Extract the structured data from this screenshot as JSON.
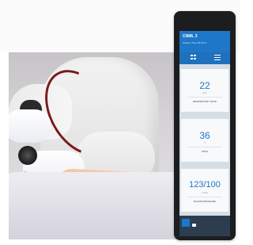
{
  "app": {
    "title": "CNML 3",
    "subtitle": "Session Time 00:10:17"
  },
  "toolbar": {
    "items": [
      {
        "label": "",
        "icon": "grid-icon"
      },
      {
        "label": "",
        "icon": "sliders-icon"
      }
    ]
  },
  "vitals": [
    {
      "value": "22",
      "unit": "bpm",
      "label": "RESPIRATORY RATE"
    },
    {
      "value": "36",
      "unit": "°C",
      "label": "SPO2"
    },
    {
      "value": "123/100",
      "unit": "mmHg",
      "label": "BLOOD PRESSURE"
    }
  ],
  "bottom_bar": {
    "text": "",
    "icon": "wifi-icon"
  },
  "colors": {
    "accent": "#1e77c8",
    "header_dark": "#1f70bd",
    "card_bg": "#f7f9fb",
    "bottom_bar": "#2b3d4f"
  }
}
